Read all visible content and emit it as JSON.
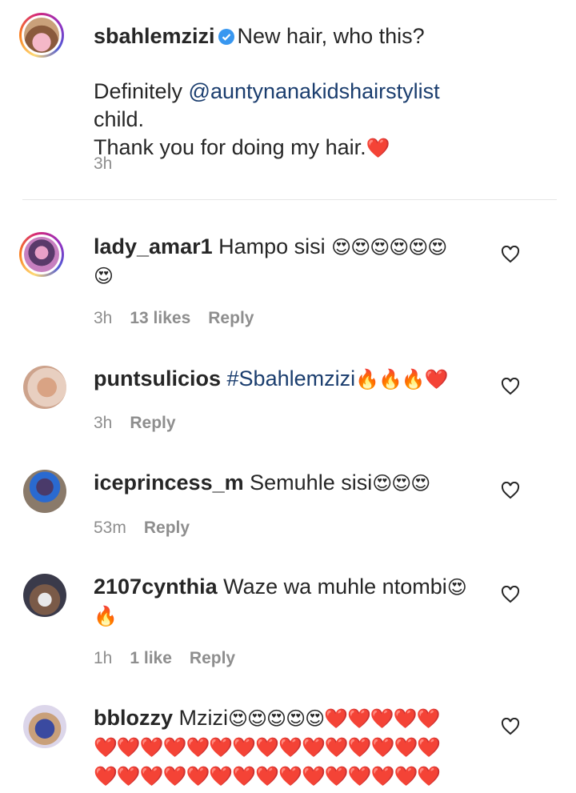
{
  "post": {
    "username": "sbahlemzizi",
    "caption_line1": "New hair, who this?",
    "caption_pre": "Definitely ",
    "caption_mention": "@auntynanakidshairstylist",
    "caption_post": " child.",
    "caption_line3": "Thank you for doing my hair.",
    "caption_emoji": "❤️",
    "time": "3h"
  },
  "comments": [
    {
      "username": "lady_amar1",
      "text": "Hampo sisi ",
      "emoji": "😍😍😍😍😍😍",
      "emoji2": "😍",
      "time": "3h",
      "likes": "13 likes",
      "reply": "Reply"
    },
    {
      "username": "puntsulicios",
      "hashtag": "#Sbahlemzizi",
      "emoji": "🔥🔥🔥❤️",
      "time": "3h",
      "reply": "Reply"
    },
    {
      "username": "iceprincess_m",
      "text": "Semuhle sisi",
      "emoji": "😍😍😍",
      "time": "53m",
      "reply": "Reply"
    },
    {
      "username": "2107cynthia",
      "text": "Waze wa muhle ntombi",
      "emoji": "😍",
      "emoji2": "🔥",
      "time": "1h",
      "likes": "1 like",
      "reply": "Reply"
    },
    {
      "username": "bblozzy",
      "text": "Mzizi",
      "emoji": "😍😍😍😍😍❤️❤️❤️❤️❤️",
      "emoji2": "❤️❤️❤️❤️❤️❤️❤️❤️❤️❤️❤️❤️❤️❤️❤️",
      "emoji3": "❤️❤️❤️❤️❤️❤️❤️❤️❤️❤️❤️❤️❤️❤️❤️"
    }
  ],
  "icons": {
    "like": "heart-outline-icon",
    "verified": "verified-badge-icon"
  },
  "colors": {
    "mention": "#1a3d6e",
    "meta": "#8e8e8e",
    "verified": "#3897f0"
  }
}
